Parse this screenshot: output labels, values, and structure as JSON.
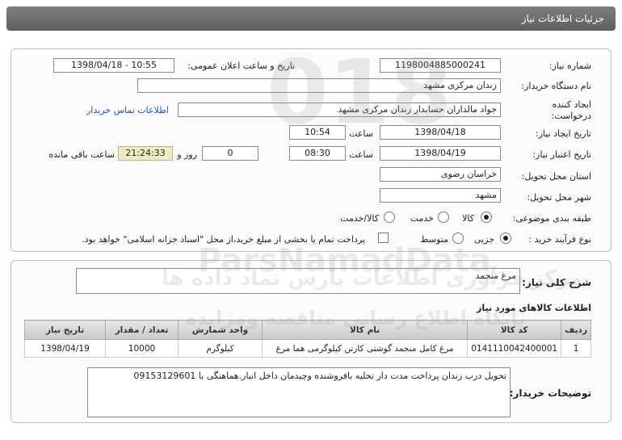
{
  "header": {
    "title": "جزئیات اطلاعات نیاز"
  },
  "form": {
    "need_number_label": "شماره نیاز:",
    "need_number": "1198004885000241",
    "announce_label": "تاریخ و ساعت اعلان عمومی:",
    "announce_value": "1398/04/18 - 10:55",
    "buyer_org_label": "نام دستگاه خریدار:",
    "buyer_org": "زندان مرکزی مشهد",
    "creator_label_1": "ایجاد کننده",
    "creator_label_2": "درخواست:",
    "creator": "جواد مالداران حسابدار زندان مرکزی مشهد",
    "contact_link": "اطلاعات تماس خریدار",
    "create_date_label": "تاریخ ایجاد نیاز:",
    "create_date": "1398/04/18",
    "time_label": "ساعت",
    "create_time": "10:54",
    "validity_label": "تاریخ اعتبار نیاز:",
    "validity_date": "1398/04/19",
    "validity_time": "08:30",
    "days_value": "0",
    "days_label": "روز و",
    "countdown": "21:24:33",
    "remaining_label": "ساعت باقی مانده",
    "province_label": "استان محل تحویل:",
    "province": "خراسان رضوی",
    "city_label": "شهر محل تحویل:",
    "city": "مشهد",
    "category_label": "طبقه بندی موضوعی:",
    "category_options": [
      "کالا",
      "خدمت",
      "کالا/خدمت"
    ],
    "category_selected": "کالا",
    "process_label": "نوع فرآیند خرید :",
    "process_options": [
      "جزیی",
      "متوسط"
    ],
    "process_selected": "جزیی",
    "payment_note": "پرداخت تمام یا بخشی از مبلغ خرید،از محل \"اسناد خزانه اسلامی\" خواهد بود."
  },
  "summary": {
    "label": "شرح کلی نیاز:",
    "value": "مرغ منجمد",
    "items_title": "اطلاعات کالاهای مورد نیاز"
  },
  "table": {
    "headers": [
      "ردیف",
      "کد کالا",
      "نام کالا",
      "واحد شمارش",
      "تعداد / مقدار",
      "تاریخ نیاز"
    ],
    "rows": [
      [
        "1",
        "0141110042400001",
        "مرغ کامل منجمد گوشتی کارتن کیلوگرمی هما مرغ",
        "کیلوگرم",
        "10000",
        "1398/04/19"
      ]
    ]
  },
  "notes": {
    "label": "توضیحات خریدار:",
    "value": "تحویل درب زندان پرداخت مدت دار تخلیه بافروشنده وچیدمان داخل انبار.هماهنگی با 09153129601"
  },
  "watermark": {
    "line1": "مرکز فرآوری اطلاعات پارس نماد داده ها",
    "line2": "پایگاه اطلاع رسانی مناقصه ومزایده",
    "brand": "ParsNamadData",
    "digits": "018"
  },
  "colors": {
    "header_bg": "#6f6f6f",
    "link": "#1a57c8",
    "countdown_bg": "#efecc4"
  }
}
